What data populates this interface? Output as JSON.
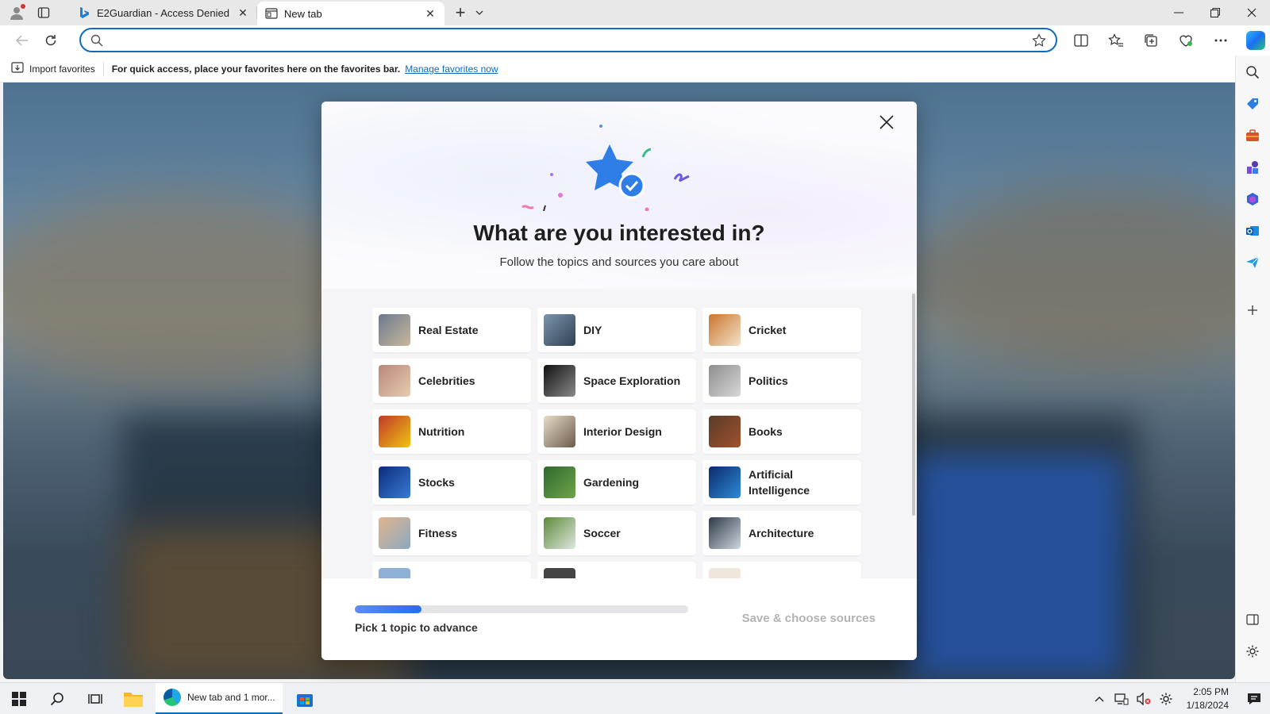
{
  "tabs": [
    {
      "title": "E2Guardian - Access Denied",
      "active": false
    },
    {
      "title": "New tab",
      "active": true
    }
  ],
  "address_bar": {
    "value": "",
    "placeholder": ""
  },
  "favorites_bar": {
    "import_label": "Import favorites",
    "message": "For quick access, place your favorites here on the favorites bar.",
    "link": "Manage favorites now"
  },
  "modal": {
    "title": "What are you interested in?",
    "subtitle": "Follow the topics and sources you care about",
    "topics": [
      {
        "label": "Real Estate",
        "color1": "#6b7a8f",
        "color2": "#c9b89c"
      },
      {
        "label": "DIY",
        "color1": "#7d96ad",
        "color2": "#2f3f52"
      },
      {
        "label": "Cricket",
        "color1": "#c9752d",
        "color2": "#f3e3c9"
      },
      {
        "label": "Celebrities",
        "color1": "#b9877a",
        "color2": "#e6cdb0"
      },
      {
        "label": "Space Exploration",
        "color1": "#111111",
        "color2": "#8a8a8a"
      },
      {
        "label": "Politics",
        "color1": "#8d8d8d",
        "color2": "#d8d8d8"
      },
      {
        "label": "Nutrition",
        "color1": "#c0392b",
        "color2": "#f1c40f"
      },
      {
        "label": "Interior Design",
        "color1": "#e8dcc8",
        "color2": "#6b5b4b"
      },
      {
        "label": "Books",
        "color1": "#5a3b2a",
        "color2": "#a0522d"
      },
      {
        "label": "Stocks",
        "color1": "#0b2c7a",
        "color2": "#3a7bd5"
      },
      {
        "label": "Gardening",
        "color1": "#2d6a2f",
        "color2": "#6fa34a"
      },
      {
        "label": "Artificial Intelligence",
        "color1": "#0a2a6b",
        "color2": "#2f8ad8"
      },
      {
        "label": "Fitness",
        "color1": "#e2b48d",
        "color2": "#8aa9c2"
      },
      {
        "label": "Soccer",
        "color1": "#5d8a3a",
        "color2": "#dfe7e0"
      },
      {
        "label": "Architecture",
        "color1": "#2d3a4a",
        "color2": "#cfd6dd"
      }
    ],
    "progress": 0.2,
    "pick_text": "Pick 1 topic to advance",
    "save_label": "Save & choose sources"
  },
  "taskbar": {
    "edge_label": "New tab and 1 mor...",
    "time": "2:05 PM",
    "date": "1/18/2024"
  },
  "colors": {
    "accent": "#0f6cbd",
    "progress": "#2a6bf0"
  }
}
